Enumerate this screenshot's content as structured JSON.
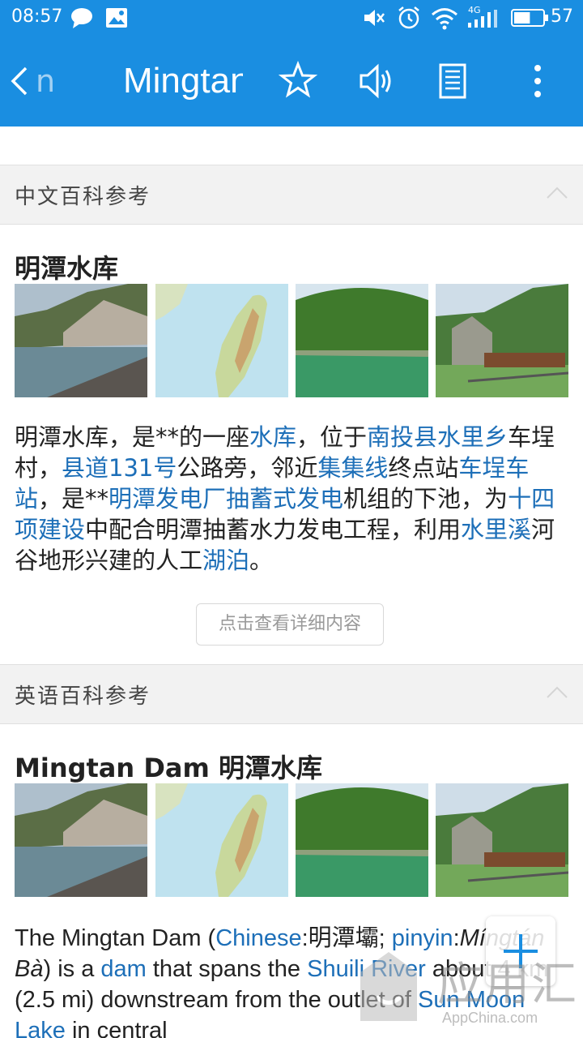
{
  "status_bar": {
    "time": "08:57",
    "network": "4G",
    "battery": "57",
    "icons": [
      "chat-icon",
      "image-notification-icon",
      "mute-icon",
      "alarm-icon",
      "wifi-icon",
      "signal-icon",
      "battery-icon"
    ]
  },
  "app_bar": {
    "back_text": "n",
    "title": "Mingtan",
    "icons": [
      "back-icon",
      "star-icon",
      "speaker-icon",
      "notebook-icon",
      "more-icon"
    ],
    "color": "#1a8ee1"
  },
  "zh_section": {
    "header": "中文百科参考",
    "entry_title": "明潭水库",
    "paragraph": [
      {
        "t": "明潭水库，是**的一座"
      },
      {
        "t": "水库",
        "link": true
      },
      {
        "t": "，位于"
      },
      {
        "t": "南投县水里乡",
        "link": true
      },
      {
        "t": "车埕村，"
      },
      {
        "t": "县道131号",
        "link": true
      },
      {
        "t": "公路旁，邻近"
      },
      {
        "t": "集集线",
        "link": true
      },
      {
        "t": "终点站"
      },
      {
        "t": "车埕车站",
        "link": true
      },
      {
        "t": "，是**"
      },
      {
        "t": "明潭发电厂抽蓄式发电",
        "link": true
      },
      {
        "t": "机组的下池，为"
      },
      {
        "t": "十四项建设",
        "link": true
      },
      {
        "t": "中配合明潭抽蓄水力发电工程，利用"
      },
      {
        "t": "水里溪",
        "link": true
      },
      {
        "t": "河谷地形兴建的人工"
      },
      {
        "t": "湖泊",
        "link": true
      },
      {
        "t": "。"
      }
    ],
    "more_button": "点击查看详细内容"
  },
  "en_section": {
    "header": "英语百科参考",
    "entry_title": "Mingtan Dam 明潭水库",
    "paragraph": [
      {
        "t": "The Mingtan Dam ("
      },
      {
        "t": "Chinese",
        "link": true
      },
      {
        "t": ":明潭壩; "
      },
      {
        "t": "pinyin",
        "link": true
      },
      {
        "t": ":"
      },
      {
        "t": "Míngtán Bà",
        "italic": true
      },
      {
        "t": ") is a "
      },
      {
        "t": "dam",
        "link": true
      },
      {
        "t": " that spans the "
      },
      {
        "t": "Shuili River",
        "link": true
      },
      {
        "t": " about 4 km (2.5 mi) downstream from the outlet of "
      },
      {
        "t": "Sun Moon Lake",
        "link": true
      },
      {
        "t": " in central"
      }
    ]
  },
  "thumbnails": [
    "reservoir-photo",
    "taiwan-map",
    "green-lake-photo",
    "train-station-photo"
  ],
  "fab": {
    "icon": "plus-icon"
  },
  "watermark": {
    "text": "应用汇",
    "url": "AppChina.com"
  },
  "colors": {
    "link": "#1d6fb8",
    "accent": "#1a8ee1",
    "section_bg": "#f2f2f2"
  }
}
